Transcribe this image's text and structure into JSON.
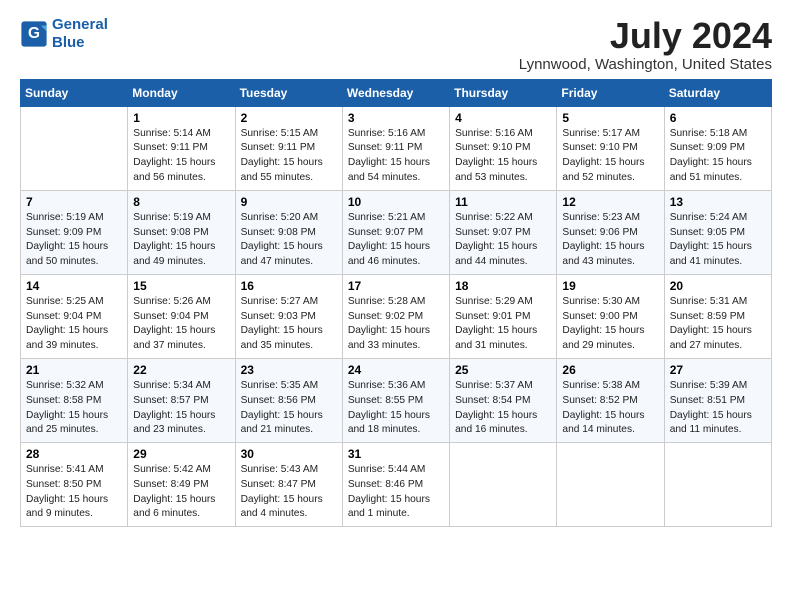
{
  "header": {
    "logo_line1": "General",
    "logo_line2": "Blue",
    "month": "July 2024",
    "location": "Lynnwood, Washington, United States"
  },
  "weekdays": [
    "Sunday",
    "Monday",
    "Tuesday",
    "Wednesday",
    "Thursday",
    "Friday",
    "Saturday"
  ],
  "weeks": [
    [
      {
        "day": "",
        "info": ""
      },
      {
        "day": "1",
        "info": "Sunrise: 5:14 AM\nSunset: 9:11 PM\nDaylight: 15 hours\nand 56 minutes."
      },
      {
        "day": "2",
        "info": "Sunrise: 5:15 AM\nSunset: 9:11 PM\nDaylight: 15 hours\nand 55 minutes."
      },
      {
        "day": "3",
        "info": "Sunrise: 5:16 AM\nSunset: 9:11 PM\nDaylight: 15 hours\nand 54 minutes."
      },
      {
        "day": "4",
        "info": "Sunrise: 5:16 AM\nSunset: 9:10 PM\nDaylight: 15 hours\nand 53 minutes."
      },
      {
        "day": "5",
        "info": "Sunrise: 5:17 AM\nSunset: 9:10 PM\nDaylight: 15 hours\nand 52 minutes."
      },
      {
        "day": "6",
        "info": "Sunrise: 5:18 AM\nSunset: 9:09 PM\nDaylight: 15 hours\nand 51 minutes."
      }
    ],
    [
      {
        "day": "7",
        "info": "Sunrise: 5:19 AM\nSunset: 9:09 PM\nDaylight: 15 hours\nand 50 minutes."
      },
      {
        "day": "8",
        "info": "Sunrise: 5:19 AM\nSunset: 9:08 PM\nDaylight: 15 hours\nand 49 minutes."
      },
      {
        "day": "9",
        "info": "Sunrise: 5:20 AM\nSunset: 9:08 PM\nDaylight: 15 hours\nand 47 minutes."
      },
      {
        "day": "10",
        "info": "Sunrise: 5:21 AM\nSunset: 9:07 PM\nDaylight: 15 hours\nand 46 minutes."
      },
      {
        "day": "11",
        "info": "Sunrise: 5:22 AM\nSunset: 9:07 PM\nDaylight: 15 hours\nand 44 minutes."
      },
      {
        "day": "12",
        "info": "Sunrise: 5:23 AM\nSunset: 9:06 PM\nDaylight: 15 hours\nand 43 minutes."
      },
      {
        "day": "13",
        "info": "Sunrise: 5:24 AM\nSunset: 9:05 PM\nDaylight: 15 hours\nand 41 minutes."
      }
    ],
    [
      {
        "day": "14",
        "info": "Sunrise: 5:25 AM\nSunset: 9:04 PM\nDaylight: 15 hours\nand 39 minutes."
      },
      {
        "day": "15",
        "info": "Sunrise: 5:26 AM\nSunset: 9:04 PM\nDaylight: 15 hours\nand 37 minutes."
      },
      {
        "day": "16",
        "info": "Sunrise: 5:27 AM\nSunset: 9:03 PM\nDaylight: 15 hours\nand 35 minutes."
      },
      {
        "day": "17",
        "info": "Sunrise: 5:28 AM\nSunset: 9:02 PM\nDaylight: 15 hours\nand 33 minutes."
      },
      {
        "day": "18",
        "info": "Sunrise: 5:29 AM\nSunset: 9:01 PM\nDaylight: 15 hours\nand 31 minutes."
      },
      {
        "day": "19",
        "info": "Sunrise: 5:30 AM\nSunset: 9:00 PM\nDaylight: 15 hours\nand 29 minutes."
      },
      {
        "day": "20",
        "info": "Sunrise: 5:31 AM\nSunset: 8:59 PM\nDaylight: 15 hours\nand 27 minutes."
      }
    ],
    [
      {
        "day": "21",
        "info": "Sunrise: 5:32 AM\nSunset: 8:58 PM\nDaylight: 15 hours\nand 25 minutes."
      },
      {
        "day": "22",
        "info": "Sunrise: 5:34 AM\nSunset: 8:57 PM\nDaylight: 15 hours\nand 23 minutes."
      },
      {
        "day": "23",
        "info": "Sunrise: 5:35 AM\nSunset: 8:56 PM\nDaylight: 15 hours\nand 21 minutes."
      },
      {
        "day": "24",
        "info": "Sunrise: 5:36 AM\nSunset: 8:55 PM\nDaylight: 15 hours\nand 18 minutes."
      },
      {
        "day": "25",
        "info": "Sunrise: 5:37 AM\nSunset: 8:54 PM\nDaylight: 15 hours\nand 16 minutes."
      },
      {
        "day": "26",
        "info": "Sunrise: 5:38 AM\nSunset: 8:52 PM\nDaylight: 15 hours\nand 14 minutes."
      },
      {
        "day": "27",
        "info": "Sunrise: 5:39 AM\nSunset: 8:51 PM\nDaylight: 15 hours\nand 11 minutes."
      }
    ],
    [
      {
        "day": "28",
        "info": "Sunrise: 5:41 AM\nSunset: 8:50 PM\nDaylight: 15 hours\nand 9 minutes."
      },
      {
        "day": "29",
        "info": "Sunrise: 5:42 AM\nSunset: 8:49 PM\nDaylight: 15 hours\nand 6 minutes."
      },
      {
        "day": "30",
        "info": "Sunrise: 5:43 AM\nSunset: 8:47 PM\nDaylight: 15 hours\nand 4 minutes."
      },
      {
        "day": "31",
        "info": "Sunrise: 5:44 AM\nSunset: 8:46 PM\nDaylight: 15 hours\nand 1 minute."
      },
      {
        "day": "",
        "info": ""
      },
      {
        "day": "",
        "info": ""
      },
      {
        "day": "",
        "info": ""
      }
    ]
  ]
}
